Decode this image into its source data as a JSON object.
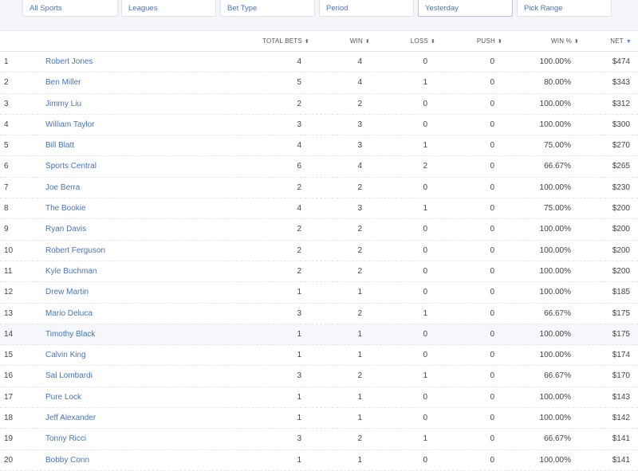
{
  "filters": [
    {
      "label": "All Sports"
    },
    {
      "label": "Leagues"
    },
    {
      "label": "Bet Type"
    },
    {
      "label": "Period"
    },
    {
      "label": "Yesterday"
    },
    {
      "label": "Pick Range"
    }
  ],
  "columns": {
    "total_bets": "TOTAL BETS",
    "win": "WIN",
    "loss": "LOSS",
    "push": "PUSH",
    "win_pct": "WIN %",
    "net": "NET"
  },
  "sort": {
    "column": "net",
    "direction": "desc",
    "sortable_icon": "sort-updown-icon",
    "active_icon": "caret-down-icon",
    "active_color": "#3f84d6"
  },
  "colors": {
    "link": "#4a74b8",
    "filter_bar_bg": "#f3f5f8"
  },
  "rows": [
    {
      "rank": "1",
      "name": "Robert Jones",
      "total": "4",
      "win": "4",
      "loss": "0",
      "push": "0",
      "pct": "100.00%",
      "net": "$474"
    },
    {
      "rank": "2",
      "name": "Ben Miller",
      "total": "5",
      "win": "4",
      "loss": "1",
      "push": "0",
      "pct": "80.00%",
      "net": "$343"
    },
    {
      "rank": "3",
      "name": "Jimmy Liu",
      "total": "2",
      "win": "2",
      "loss": "0",
      "push": "0",
      "pct": "100.00%",
      "net": "$312"
    },
    {
      "rank": "4",
      "name": "William Taylor",
      "total": "3",
      "win": "3",
      "loss": "0",
      "push": "0",
      "pct": "100.00%",
      "net": "$300"
    },
    {
      "rank": "5",
      "name": "Bill Blatt",
      "total": "4",
      "win": "3",
      "loss": "1",
      "push": "0",
      "pct": "75.00%",
      "net": "$270"
    },
    {
      "rank": "6",
      "name": "Sports Central",
      "total": "6",
      "win": "4",
      "loss": "2",
      "push": "0",
      "pct": "66.67%",
      "net": "$265"
    },
    {
      "rank": "7",
      "name": "Joe Berra",
      "total": "2",
      "win": "2",
      "loss": "0",
      "push": "0",
      "pct": "100.00%",
      "net": "$230"
    },
    {
      "rank": "8",
      "name": "The Bookie",
      "total": "4",
      "win": "3",
      "loss": "1",
      "push": "0",
      "pct": "75.00%",
      "net": "$200"
    },
    {
      "rank": "9",
      "name": "Ryan Davis",
      "total": "2",
      "win": "2",
      "loss": "0",
      "push": "0",
      "pct": "100.00%",
      "net": "$200"
    },
    {
      "rank": "10",
      "name": "Robert Ferguson",
      "total": "2",
      "win": "2",
      "loss": "0",
      "push": "0",
      "pct": "100.00%",
      "net": "$200"
    },
    {
      "rank": "11",
      "name": "Kyle Buchman",
      "total": "2",
      "win": "2",
      "loss": "0",
      "push": "0",
      "pct": "100.00%",
      "net": "$200"
    },
    {
      "rank": "12",
      "name": "Drew Martin",
      "total": "1",
      "win": "1",
      "loss": "0",
      "push": "0",
      "pct": "100.00%",
      "net": "$185"
    },
    {
      "rank": "13",
      "name": "Mario Deluca",
      "total": "3",
      "win": "2",
      "loss": "1",
      "push": "0",
      "pct": "66.67%",
      "net": "$175"
    },
    {
      "rank": "14",
      "name": "Timothy Black",
      "total": "1",
      "win": "1",
      "loss": "0",
      "push": "0",
      "pct": "100.00%",
      "net": "$175"
    },
    {
      "rank": "15",
      "name": "Calvin King",
      "total": "1",
      "win": "1",
      "loss": "0",
      "push": "0",
      "pct": "100.00%",
      "net": "$174"
    },
    {
      "rank": "16",
      "name": "Sal Lombardi",
      "total": "3",
      "win": "2",
      "loss": "1",
      "push": "0",
      "pct": "66.67%",
      "net": "$170"
    },
    {
      "rank": "17",
      "name": "Pure Lock",
      "total": "1",
      "win": "1",
      "loss": "0",
      "push": "0",
      "pct": "100.00%",
      "net": "$143"
    },
    {
      "rank": "18",
      "name": "Jeff Alexander",
      "total": "1",
      "win": "1",
      "loss": "0",
      "push": "0",
      "pct": "100.00%",
      "net": "$142"
    },
    {
      "rank": "19",
      "name": "Tonny Ricci",
      "total": "3",
      "win": "2",
      "loss": "1",
      "push": "0",
      "pct": "66.67%",
      "net": "$141"
    },
    {
      "rank": "20",
      "name": "Bobby Conn",
      "total": "1",
      "win": "1",
      "loss": "0",
      "push": "0",
      "pct": "100.00%",
      "net": "$141"
    }
  ]
}
